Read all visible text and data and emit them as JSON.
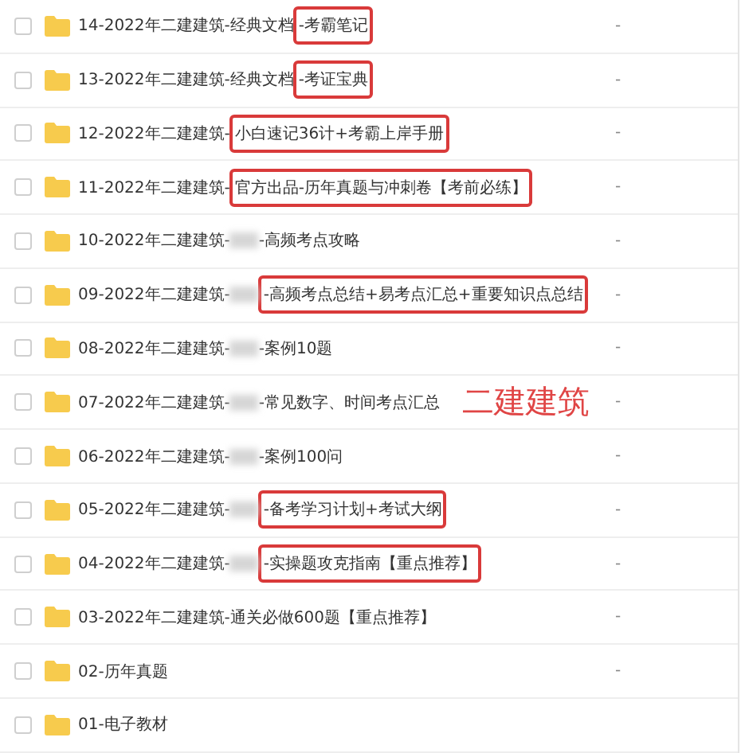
{
  "files": [
    {
      "checked": false,
      "name": "14-2022年二建建筑-经典文档",
      "tail": "-考霸笔记",
      "redacted": false,
      "boxed": true,
      "size": "-"
    },
    {
      "checked": false,
      "name": "13-2022年二建建筑-经典文档",
      "tail": "-考证宝典",
      "redacted": false,
      "boxed": true,
      "size": "-"
    },
    {
      "checked": false,
      "name": "12-2022年二建建筑-",
      "tail": "小白速记36计+考霸上岸手册",
      "redacted": false,
      "boxed": true,
      "size": "-"
    },
    {
      "checked": false,
      "name": "11-2022年二建建筑-",
      "tail": "官方出品-历年真题与冲刺卷【考前必练】",
      "redacted": false,
      "boxed": true,
      "size": "-"
    },
    {
      "checked": false,
      "name": "10-2022年二建建筑-",
      "tail": "-高频考点攻略",
      "redacted": true,
      "boxed": false,
      "size": "-"
    },
    {
      "checked": false,
      "name": "09-2022年二建建筑-",
      "tail": "-高频考点总结+易考点汇总+重要知识点总结",
      "redacted": true,
      "boxed": true,
      "size": "-"
    },
    {
      "checked": false,
      "name": "08-2022年二建建筑-",
      "tail": "-案例10题",
      "redacted": true,
      "boxed": false,
      "size": "-"
    },
    {
      "checked": false,
      "name": "07-2022年二建建筑-",
      "tail": "-常见数字、时间考点汇总",
      "redacted": true,
      "boxed": false,
      "size": "-"
    },
    {
      "checked": false,
      "name": "06-2022年二建建筑-",
      "tail": "-案例100问",
      "redacted": true,
      "boxed": false,
      "size": "-"
    },
    {
      "checked": false,
      "name": "05-2022年二建建筑-",
      "tail": "-备考学习计划+考试大纲",
      "redacted": true,
      "boxed": true,
      "size": "-"
    },
    {
      "checked": false,
      "name": "04-2022年二建建筑-",
      "tail": "-实操题攻克指南【重点推荐】",
      "redacted": true,
      "boxed": true,
      "size": "-"
    },
    {
      "checked": false,
      "name": "03-2022年二建建筑-通关必做600题【重点推荐】",
      "size": "-"
    },
    {
      "checked": false,
      "name": "02-历年真题",
      "size": "-"
    },
    {
      "checked": false,
      "name": "01-电子教材"
    }
  ],
  "annotation": {
    "text": "二建建筑"
  }
}
